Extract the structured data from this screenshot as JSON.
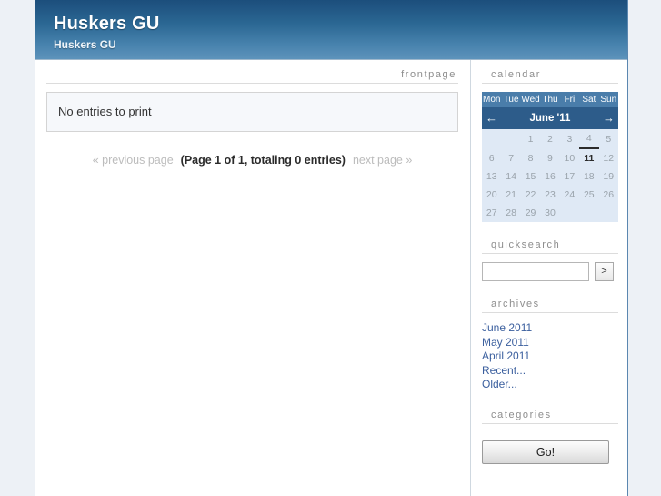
{
  "header": {
    "title": "Huskers GU",
    "subtitle": "Huskers GU"
  },
  "main": {
    "section_label": "frontpage",
    "entry_message": "No entries to print",
    "pagination": {
      "previous": "« previous page",
      "current": "(Page 1 of 1, totaling 0 entries)",
      "next": "next page »"
    }
  },
  "sidebar": {
    "calendar": {
      "heading": "calendar",
      "prev_icon": "←",
      "next_icon": "→",
      "month_label": "June '11",
      "weekdays": [
        "Mon",
        "Tue",
        "Wed",
        "Thu",
        "Fri",
        "Sat",
        "Sun"
      ],
      "today": "11",
      "weeks": [
        [
          "",
          "",
          "1",
          "2",
          "3",
          "4",
          "5"
        ],
        [
          "6",
          "7",
          "8",
          "9",
          "10",
          "11",
          "12"
        ],
        [
          "13",
          "14",
          "15",
          "16",
          "17",
          "18",
          "19"
        ],
        [
          "20",
          "21",
          "22",
          "23",
          "24",
          "25",
          "26"
        ],
        [
          "27",
          "28",
          "29",
          "30",
          "",
          "",
          ""
        ]
      ]
    },
    "quicksearch": {
      "heading": "quicksearch",
      "value": "",
      "placeholder": "",
      "submit_label": ">"
    },
    "archives": {
      "heading": "archives",
      "links": [
        "June 2011",
        "May 2011",
        "April 2011",
        "Recent...",
        "Older..."
      ]
    },
    "categories": {
      "heading": "categories",
      "go_label": "Go!"
    }
  },
  "colors": {
    "header_top": "#1c4e7c",
    "header_bottom": "#5d93bb",
    "page_bg": "#edf1f6",
    "link": "#3b5f9e",
    "calendar_nav": "#2d5c8a",
    "calendar_dow": "#4a7daa",
    "calendar_body": "#dfe9f5"
  }
}
